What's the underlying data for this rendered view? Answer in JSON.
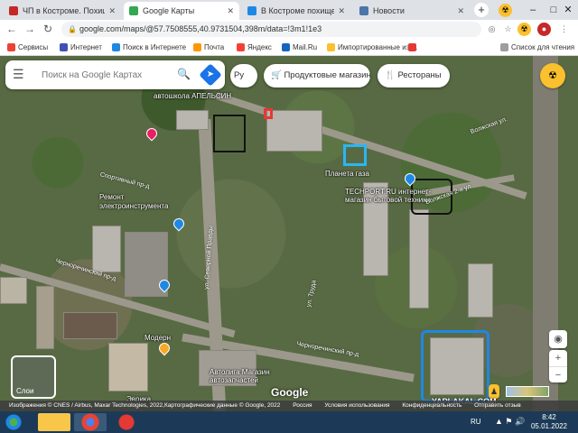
{
  "browser": {
    "tabs": [
      {
        "title": "ЧП в Костроме. Похищен",
        "favicon_color": "#c62828",
        "active": false
      },
      {
        "title": "Google Карты",
        "favicon_color": "#34a853",
        "active": true
      },
      {
        "title": "В Костроме похищена да",
        "favicon_color": "#1e88e5",
        "active": false
      },
      {
        "title": "Новости",
        "favicon_color": "#4a76a8",
        "active": false
      }
    ],
    "new_tab_label": "+",
    "url": "google.com/maps/@57.7508555,40.9731504,398m/data=!3m1!1e3"
  },
  "bookmarks": [
    {
      "label": "Сервисы",
      "color": "#ea4335"
    },
    {
      "label": "Интернет",
      "color": "#3f51b5"
    },
    {
      "label": "Поиск в Интернете",
      "color": "#1e88e5"
    },
    {
      "label": "Почта",
      "color": "#ff9800"
    },
    {
      "label": "Яндекс",
      "color": "#f44336"
    },
    {
      "label": "Mail.Ru",
      "color": "#1565c0"
    },
    {
      "label": "Импортированные из ...",
      "color": "#fbc02d"
    }
  ],
  "reading_list": "Список для чтения",
  "maps": {
    "search_placeholder": "Поиск на Google Картах",
    "lang_chip": "Ру",
    "chips": [
      "Продуктовые магазины",
      "Рестораны"
    ],
    "labels": [
      "автошкола АПЕЛЬСИН",
      "Планета газа",
      "TECHPORT.RU интернет-магазин бытовой техники",
      "Ремонт электроинструмента",
      "Модерн",
      "Автолига Магазин автозапчастей",
      "Эврика"
    ],
    "streets": [
      "Волжская ул.",
      "Волжская 2-я ул.",
      "Спортивный пр-д",
      "Черноречинский пр-д",
      "ул. Северной Правды",
      "Черноречинский пр-д",
      "ул. Труда"
    ],
    "layers_label": "Слои",
    "logo": "Google",
    "attribution": [
      "Изображения © CNES / Airbus, Maxar Technologies, 2022,Картографические данные © Google, 2022",
      "Россия",
      "Условия использования",
      "Конфиденциальность",
      "Отправить отзыв"
    ],
    "watermark": "YAPLAKAL.COM"
  },
  "taskbar": {
    "lang": "RU",
    "time": "8:42",
    "date": "05.01.2022"
  }
}
